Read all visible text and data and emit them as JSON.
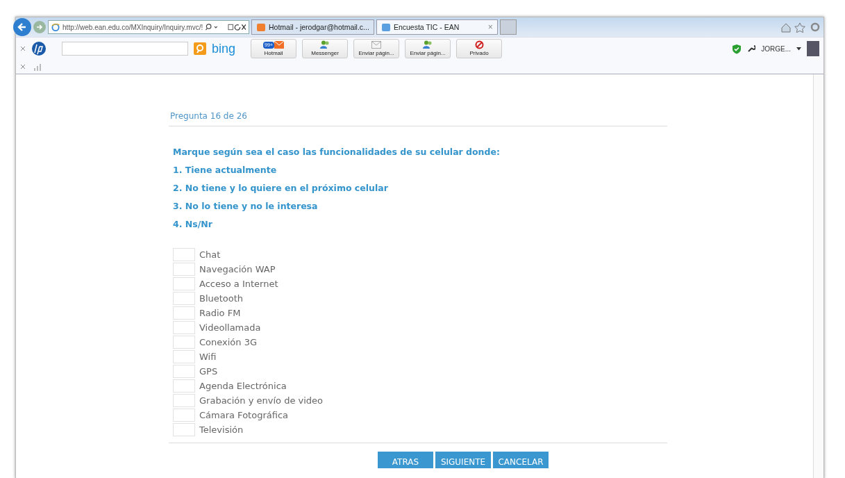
{
  "browser": {
    "address": "http://web.ean.edu.co/MXInquiry/Inquiry.mvc/!",
    "tabs": [
      {
        "title": "Hotmail - jerodgar@hotmail.c...",
        "selected": false
      },
      {
        "title": "Encuesta TIC - EAN",
        "selected": true,
        "close": "×"
      }
    ],
    "search_logo": "bing",
    "toolbar_buttons": [
      {
        "kind": "mail",
        "label": "Hotmail",
        "badge": "99+"
      },
      {
        "kind": "people",
        "label": "Messenger"
      },
      {
        "kind": "envelope",
        "label": "Enviar págin..."
      },
      {
        "kind": "people",
        "label": "Enviar págin..."
      },
      {
        "kind": "block",
        "label": "Privado"
      }
    ],
    "user": "JORGE..."
  },
  "survey": {
    "progress": "Pregunta 16 de 26",
    "instructions": [
      "Marque según sea el caso las funcionalidades de su celular donde:",
      "1. Tiene actualmente",
      "2. No tiene y lo quiere en el próximo celular",
      "3. No lo tiene y no le interesa",
      "4. Ns/Nr"
    ],
    "items": [
      "Chat",
      "Navegación WAP",
      "Acceso a Internet",
      "Bluetooth",
      "Radio FM",
      "Videollamada",
      "Conexión 3G",
      "Wifi",
      "GPS",
      "Agenda Electrónica",
      "Grabación y envío de video",
      "Cámara Fotográfica",
      "Televisión"
    ],
    "buttons": [
      "ATRAS",
      "SIGUIENTE",
      "CANCELAR"
    ]
  }
}
